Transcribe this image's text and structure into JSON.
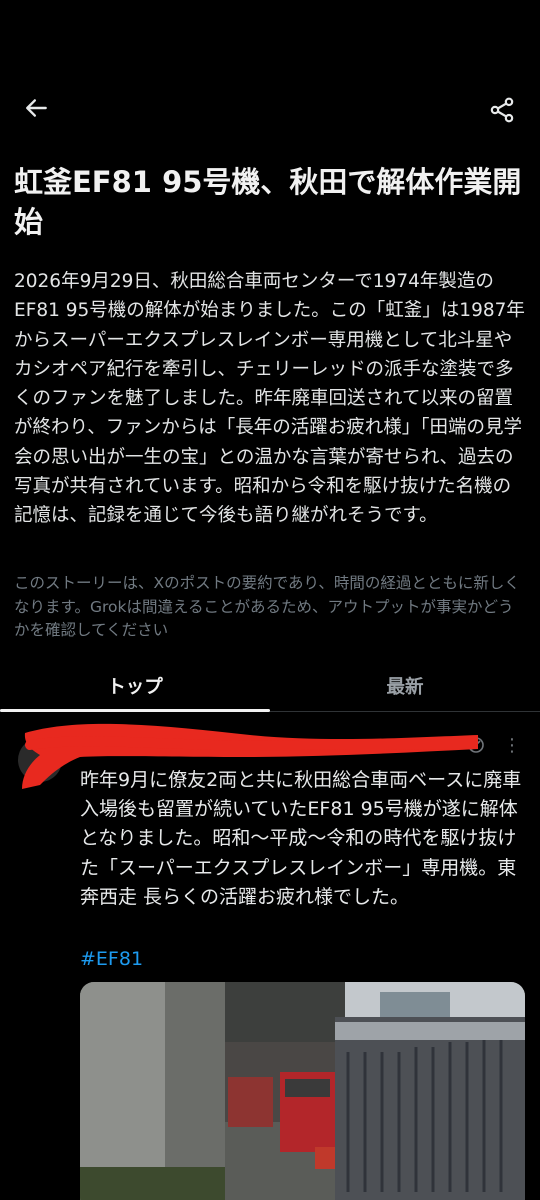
{
  "header": {
    "back_icon": "back-arrow-icon",
    "share_icon": "share-icon"
  },
  "story": {
    "title": "虹釜EF81 95号機、秋田で解体作業開始",
    "body": "2026年9月29日、秋田総合車両センターで1974年製造のEF81 95号機の解体が始まりました。この「虹釜」は1987年からスーパーエクスプレスレインボー専用機として北斗星やカシオペア紀行を牽引し、チェリーレッドの派手な塗装で多くのファンを魅了しました。昨年廃車回送されて以来の留置が終わり、ファンからは「長年の活躍お疲れ様」「田端の見学会の思い出が一生の宝」との温かな言葉が寄せられ、過去の写真が共有されています。昭和から令和を駆け抜けた名機の記憶は、記録を通じて今後も語り継がれそうです。",
    "disclaimer": "このストーリーは、Xのポストの要約であり、時間の経過とともに新しくなります。Grokは間違えることがあるため、アウトプットが事実かどうかを確認してください"
  },
  "tabs": [
    {
      "label": "トップ",
      "active": true
    },
    {
      "label": "最新",
      "active": false
    }
  ],
  "post": {
    "text": "昨年9月に僚友2両と共に秋田総合車両ベースに廃車入場後も留置が続いていたEF81 95号機が遂に解体となりました。昭和〜平成〜令和の時代を駆け抜けた「スーパーエクスプレスレインボー」専用機。東奔西走 長らくの活躍お疲れ様でした。",
    "hashtag": "#EF81",
    "more_icon": "more-dots-icon",
    "redaction_color": "#e8291f"
  },
  "colors": {
    "background": "#000000",
    "link": "#1d9bf0",
    "redaction": "#e8291f"
  }
}
